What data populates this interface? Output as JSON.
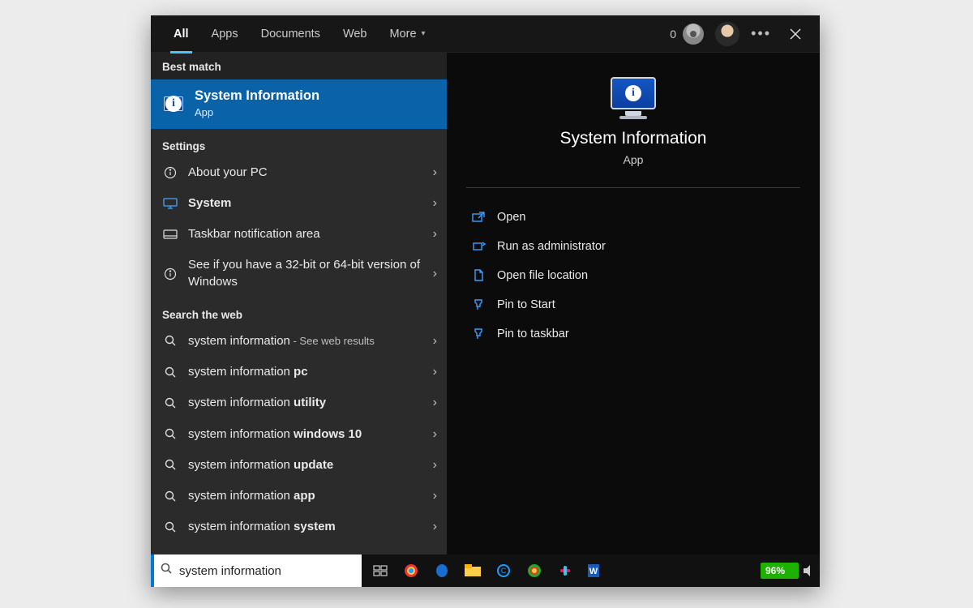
{
  "tabs": {
    "all": "All",
    "apps": "Apps",
    "documents": "Documents",
    "web": "Web",
    "more": "More"
  },
  "rewards": {
    "points": "0"
  },
  "sections": {
    "best_match": "Best match",
    "settings": "Settings",
    "search_web": "Search the web"
  },
  "best_match": {
    "title": "System Information",
    "subtitle": "App"
  },
  "settings_items": {
    "about_pc": "About your PC",
    "system": "System",
    "taskbar_notif": "Taskbar notification area",
    "bits": "See if you have a 32-bit or 64-bit version of Windows"
  },
  "web_items": {
    "q0_prefix": "system information",
    "q0_suffix": " - See web results",
    "q1_prefix": "system information ",
    "q1_bold": "pc",
    "q2_prefix": "system information ",
    "q2_bold": "utility",
    "q3_prefix": "system information ",
    "q3_bold": "windows 10",
    "q4_prefix": "system information ",
    "q4_bold": "update",
    "q5_prefix": "system information ",
    "q5_bold": "app",
    "q6_prefix": "system information ",
    "q6_bold": "system"
  },
  "details": {
    "title": "System Information",
    "subtitle": "App",
    "actions": {
      "open": "Open",
      "run_admin": "Run as administrator",
      "open_loc": "Open file location",
      "pin_start": "Pin to Start",
      "pin_taskbar": "Pin to taskbar"
    }
  },
  "search": {
    "value": "system information"
  },
  "battery": {
    "percent": "96%"
  }
}
